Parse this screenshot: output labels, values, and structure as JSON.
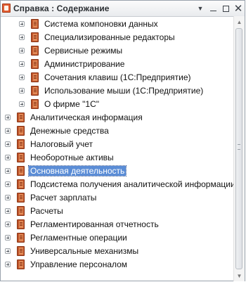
{
  "window": {
    "title": "Справка : Содержание",
    "menu_glyph": "▼",
    "close_glyph": "✕"
  },
  "scrollbar": {
    "up_glyph": "▲",
    "down_glyph": "▼",
    "position": 0.0
  },
  "tree": {
    "selected_index": 12,
    "items": [
      {
        "label": "Система компоновки данных",
        "level": 1
      },
      {
        "label": "Специализированные редакторы",
        "level": 1
      },
      {
        "label": "Сервисные режимы",
        "level": 1
      },
      {
        "label": "Администрирование",
        "level": 1
      },
      {
        "label": "Сочетания клавиш (1С:Предприятие)",
        "level": 1
      },
      {
        "label": "Использование мыши (1С:Предприятие)",
        "level": 1
      },
      {
        "label": "О фирме \"1С\"",
        "level": 1
      },
      {
        "label": "Аналитическая информация",
        "level": 0
      },
      {
        "label": "Денежные средства",
        "level": 0
      },
      {
        "label": "Налоговый учет",
        "level": 0
      },
      {
        "label": "Необоротные активы",
        "level": 0
      },
      {
        "label": "Основная деятельность",
        "level": 0
      },
      {
        "label": "Подсистема получения аналитической информации",
        "level": 0
      },
      {
        "label": "Расчет зарплаты",
        "level": 0
      },
      {
        "label": "Расчеты",
        "level": 0
      },
      {
        "label": "Регламентированная отчетность",
        "level": 0
      },
      {
        "label": "Регламентные операции",
        "level": 0
      },
      {
        "label": "Универсальные механизмы",
        "level": 0
      },
      {
        "label": "Управление персоналом",
        "level": 0
      }
    ]
  }
}
